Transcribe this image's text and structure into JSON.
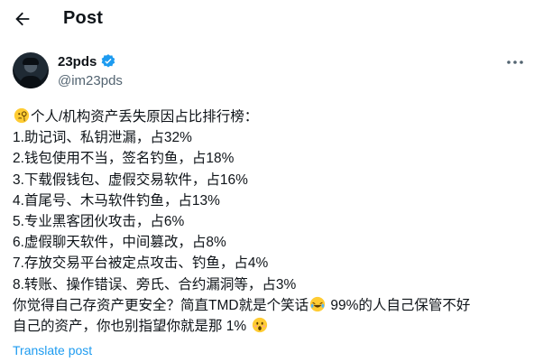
{
  "header": {
    "title": "Post"
  },
  "user": {
    "name": "23pds",
    "handle": "@im23pds"
  },
  "post": {
    "intro": "个人/机构资产丢失原因占比排行榜：",
    "items": [
      "1.助记词、私钥泄漏，占32%",
      "2.钱包使用不当，签名钓鱼，占18%",
      "3.下载假钱包、虚假交易软件，占16%",
      "4.首尾号、木马软件钓鱼，占13%",
      "5.专业黑客团伙攻击，占6%",
      "6.虚假聊天软件，中间篡改，占8%",
      "7.存放交易平台被定点攻击、钓鱼，占4%",
      "8.转账、操作错误、旁氏、合约漏洞等，占3%"
    ],
    "closing_part1": "你觉得自己存资产更安全？简直TMD就是个笑话",
    "closing_part2": " 99%的人自己保管不好",
    "closing_line2": "自己的资产，你也别指望你就是那 1%"
  },
  "translate_label": "Translate post",
  "icons": {
    "back": "arrow-left-icon",
    "verified": "verified-badge-icon",
    "more": "more-horizontal-icon",
    "intro_emoji": "face-with-monocle-icon",
    "laugh_emoji": "rolling-on-floor-laughing-icon",
    "surprise_emoji": "hushed-face-icon"
  },
  "colors": {
    "accent": "#1d9bf0",
    "text": "#0f1419",
    "muted": "#536471"
  }
}
